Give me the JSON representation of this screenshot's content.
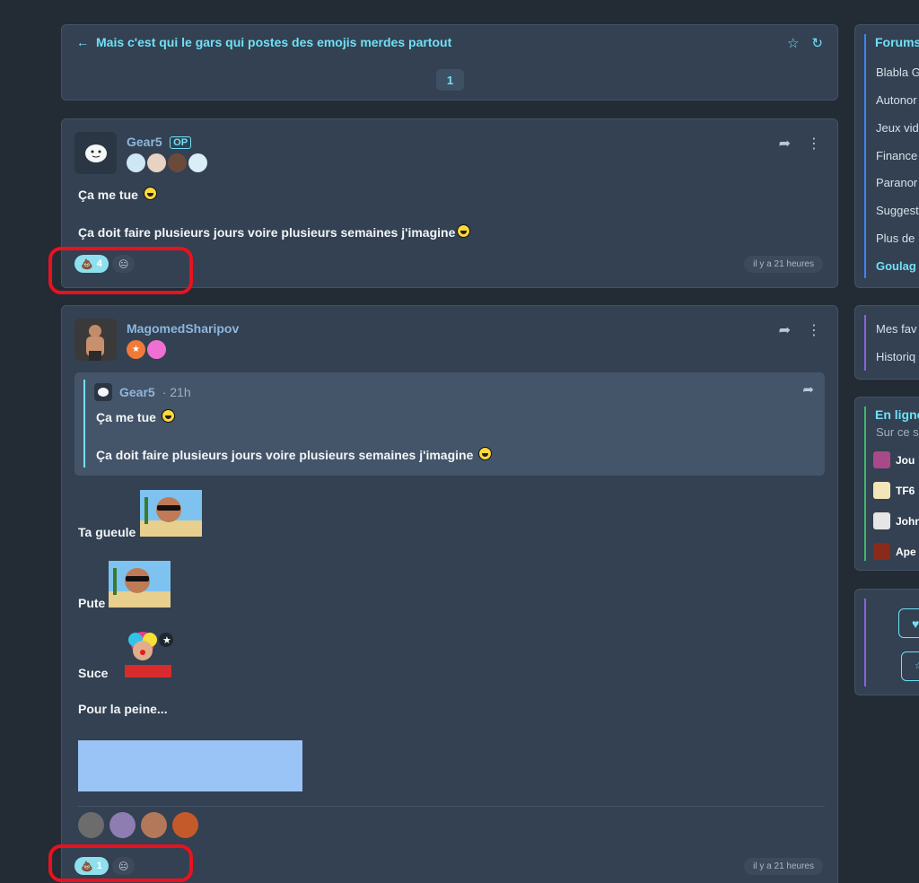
{
  "topic": {
    "title": "Mais c'est qui le gars qui postes des emojis merdes partout",
    "back_icon": "arrow-left-icon",
    "star_icon": "star-icon",
    "refresh_icon": "refresh-icon",
    "current_page": "1"
  },
  "posts": [
    {
      "author": "Gear5",
      "op_label": "OP",
      "lines": [
        "Ça me tue",
        "Ça doit faire plusieurs jours voire plusieurs semaines j'imagine"
      ],
      "reactions": [
        {
          "icon": "poop-emoji",
          "count": "4"
        },
        {
          "icon": "neutral-face-emoji",
          "count": ""
        }
      ],
      "timestamp": "il y a 21 heures"
    },
    {
      "author": "MagomedSharipov",
      "quote": {
        "author": "Gear5",
        "time": "· 21h",
        "lines": [
          "Ça me tue",
          "Ça doit faire plusieurs jours voire plusieurs semaines j'imagine"
        ]
      },
      "lines": [
        "Ta gueule",
        "Pute",
        "Suce",
        "Pour la peine..."
      ],
      "reactions": [
        {
          "icon": "poop-emoji",
          "count": "1"
        },
        {
          "icon": "neutral-face-emoji",
          "count": ""
        }
      ],
      "timestamp": "il y a 21 heures"
    }
  ],
  "sidebar": {
    "forums_title": "Forums",
    "forums": [
      "Blabla G",
      "Autonor",
      "Jeux vid",
      "Finance",
      "Paranor",
      "Suggest",
      "Plus de",
      "Goulag"
    ],
    "links": [
      "Mes fav",
      "Historiq"
    ],
    "online_title": "En ligne",
    "online_subtitle": "Sur ce s",
    "online_users": [
      "Jou",
      "TF6",
      "John",
      "Ape"
    ]
  },
  "colors": {
    "accent": "#6fe0f5",
    "background": "#232b35",
    "card": "#334152",
    "highlight": "#e8121f"
  }
}
